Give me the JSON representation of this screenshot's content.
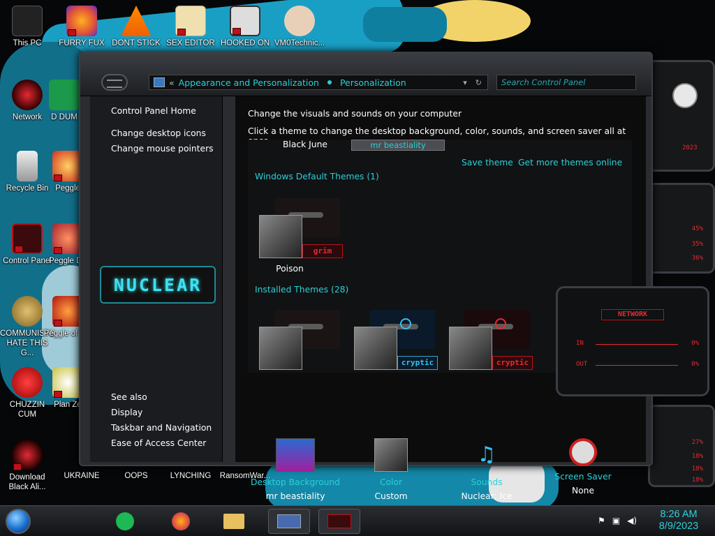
{
  "desktop": {
    "icons": [
      {
        "label": "This PC"
      },
      {
        "label": "FURRY FUX"
      },
      {
        "label": "DONT STICK"
      },
      {
        "label": "SEX EDITOR"
      },
      {
        "label": "HOOKED ON"
      },
      {
        "label": "VM0Technic..."
      },
      {
        "label": "Network"
      },
      {
        "label": "D DUM"
      },
      {
        "label": "Recycle Bin"
      },
      {
        "label": "Peggle"
      },
      {
        "label": "Control Panel"
      },
      {
        "label": "Peggle De"
      },
      {
        "label": "COMMUNISTS HATE THIS G..."
      },
      {
        "label": "Peggle of Wa"
      },
      {
        "label": "CHUZZIN CUM"
      },
      {
        "label": "Plan Zo"
      },
      {
        "label": "Download Black Ali..."
      },
      {
        "label": "UKRAINE"
      },
      {
        "label": "OOPS"
      },
      {
        "label": "LYNCHING"
      },
      {
        "label": "RansomWar..."
      }
    ]
  },
  "window": {
    "address": {
      "back": "«",
      "crumb1": "Appearance and Personalization",
      "crumb2": "Personalization"
    },
    "search": {
      "placeholder": "Search Control Panel"
    },
    "sidebar": {
      "home": "Control Panel Home",
      "links": [
        "Change desktop icons",
        "Change mouse pointers"
      ],
      "logo_text": "NUCLEAR",
      "see_also_title": "See also",
      "see_also": [
        "Display",
        "Taskbar and Navigation",
        "Ease of Access Center"
      ]
    },
    "content": {
      "heading": "Change the visuals and sounds on your computer",
      "subheading": "Click a theme to change the desktop background, color, sounds, and screen saver all at once.",
      "current_theme_name": "Black June",
      "selected_theme": "mr beastiality",
      "save_theme": "Save theme",
      "get_more": "Get more themes online",
      "default_group": "Windows Default Themes (1)",
      "installed_group": "Installed Themes (28)",
      "default_themes": [
        {
          "name": "Poison",
          "tag": "grim"
        }
      ],
      "installed_themes": [
        {
          "tag": ""
        },
        {
          "tag": "cryptic"
        },
        {
          "tag": "cryptic"
        }
      ]
    },
    "bottom": [
      {
        "label": "Desktop Background",
        "value": "mr beastiality",
        "icon": "wallpaper-thumb-icon"
      },
      {
        "label": "Color",
        "value": "Custom",
        "icon": "color-swatch-icon"
      },
      {
        "label": "Sounds",
        "value": "Nuclear: Ice",
        "icon": "music-notes-icon"
      },
      {
        "label": "Screen Saver",
        "value": "None",
        "icon": "no-screensaver-icon"
      }
    ]
  },
  "gadgets": {
    "network": {
      "title": "NETWORK",
      "in_label": "IN",
      "in_pct": "0%",
      "out_label": "OUT",
      "out_pct": "0%"
    },
    "side_pcts": [
      "45%",
      "35%",
      "36%",
      "27%",
      "18%",
      "18%",
      "18%"
    ],
    "year": "2023"
  },
  "taskbar": {
    "time": "8:26 AM",
    "date": "8/9/2023"
  }
}
